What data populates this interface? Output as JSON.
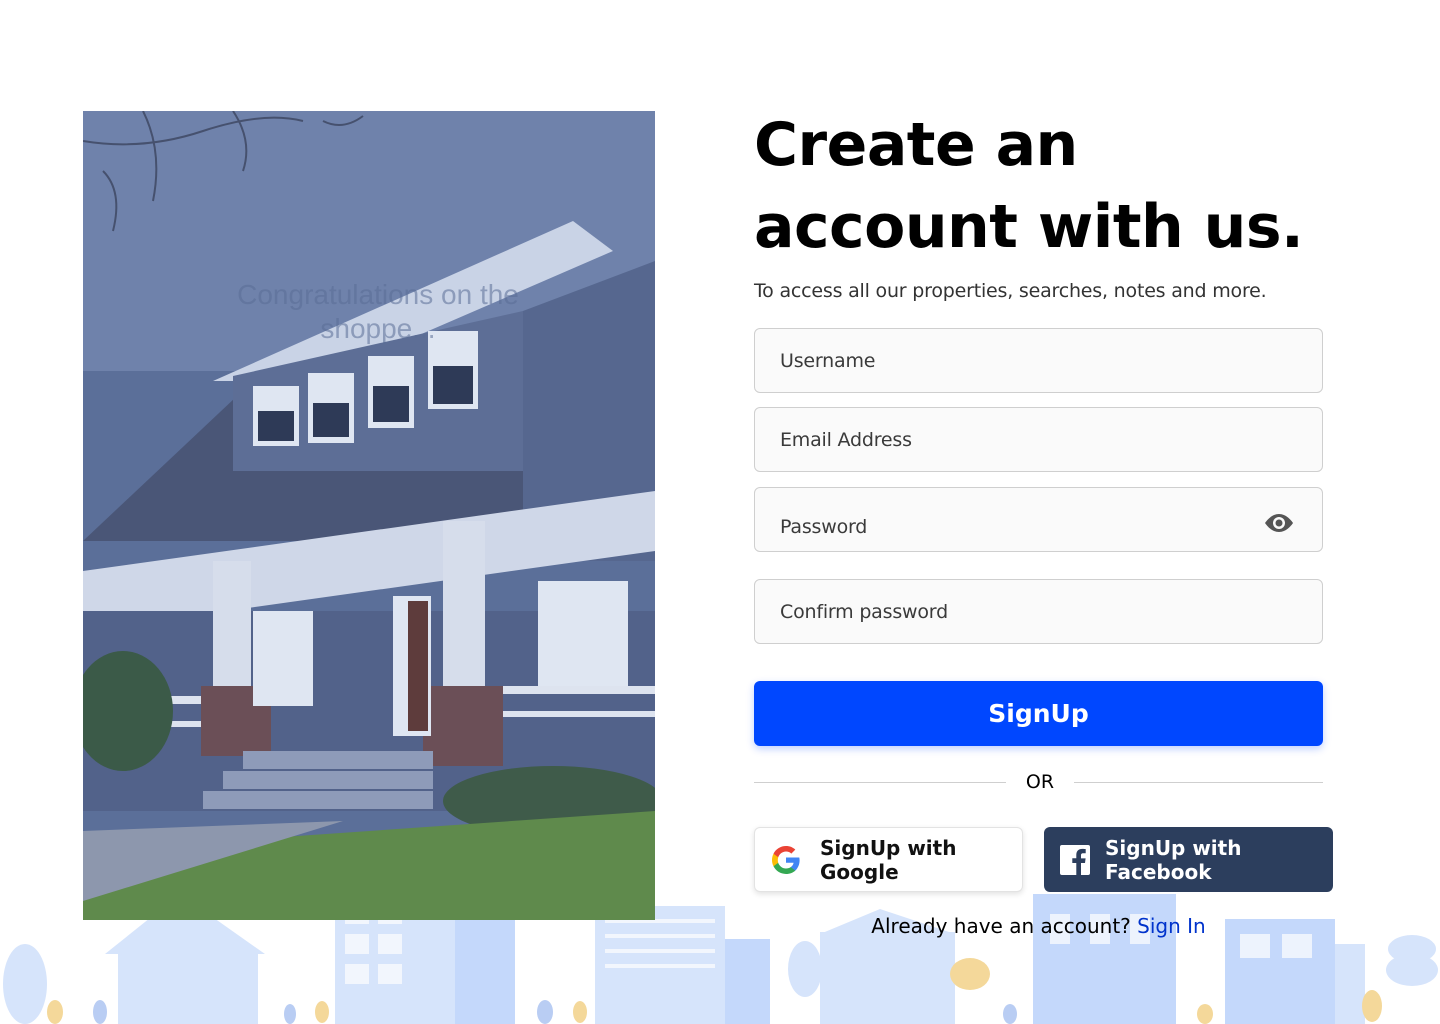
{
  "form": {
    "title_line1": "Create an",
    "title_line2": "account with us.",
    "subtitle": "To access all our properties, searches, notes and more.",
    "fields": {
      "username_placeholder": "Username",
      "email_placeholder": "Email Address",
      "password_placeholder": "Password",
      "confirm_placeholder": "Confirm password"
    },
    "signup_label": "SignUp",
    "divider_label": "OR",
    "google_label": "SignUp with Google",
    "facebook_label": "SignUp with Facebook",
    "signin_prompt": "Already have an account?",
    "signin_link": "Sign In"
  },
  "hero": {
    "overlay_text": "Congratulations on the shoppe..."
  },
  "colors": {
    "primary": "#0047ff",
    "facebook": "#2c3e5d",
    "link": "#0033cc",
    "skyline": "#cfe0fb"
  },
  "icons": {
    "password_toggle": "eye-icon",
    "google": "google-logo-icon",
    "facebook": "facebook-logo-icon"
  }
}
